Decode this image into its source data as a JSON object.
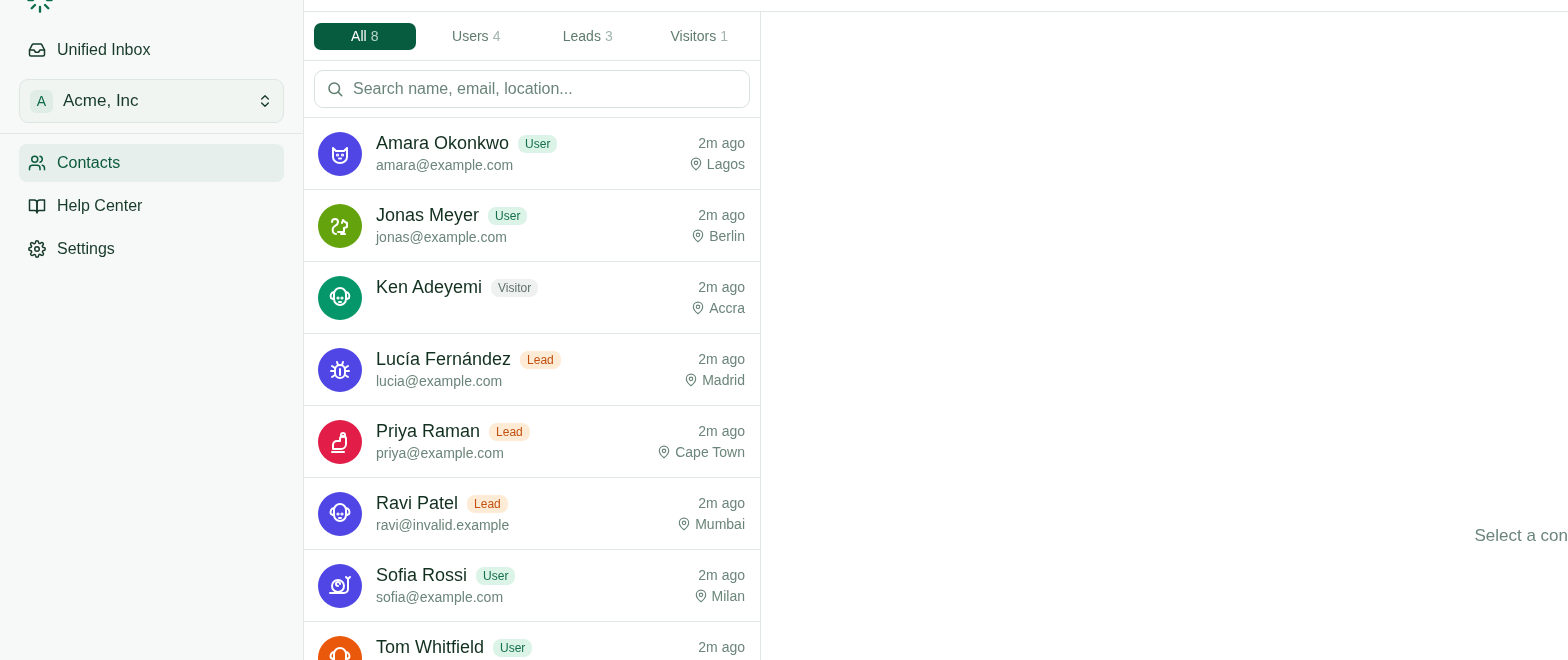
{
  "sidebar": {
    "items": [
      {
        "label": "Unified Inbox",
        "selected": false
      }
    ],
    "workspace": {
      "initial": "A",
      "name": "Acme, Inc"
    },
    "nav": [
      {
        "label": "Contacts",
        "selected": true
      },
      {
        "label": "Help Center",
        "selected": false
      },
      {
        "label": "Settings",
        "selected": false
      }
    ]
  },
  "tabs": [
    {
      "label": "All",
      "count": "8",
      "selected": true
    },
    {
      "label": "Users",
      "count": "4",
      "selected": false
    },
    {
      "label": "Leads",
      "count": "3",
      "selected": false
    },
    {
      "label": "Visitors",
      "count": "1",
      "selected": false
    }
  ],
  "search": {
    "placeholder": "Search name, email, location..."
  },
  "contacts": [
    {
      "name": "Amara Okonkwo",
      "badge": {
        "label": "User",
        "kind": "user"
      },
      "email": "amara@example.com",
      "time": "2m ago",
      "location": "Lagos",
      "color": "#4f46e5"
    },
    {
      "name": "Jonas Meyer",
      "badge": {
        "label": "User",
        "kind": "user"
      },
      "email": "jonas@example.com",
      "time": "2m ago",
      "location": "Berlin",
      "color": "#65a30d"
    },
    {
      "name": "Ken Adeyemi",
      "badge": {
        "label": "Visitor",
        "kind": "visitor"
      },
      "time": "2m ago",
      "location": "Accra",
      "color": "#059669"
    },
    {
      "name": "Lucía Fernández",
      "badge": {
        "label": "Lead",
        "kind": "lead"
      },
      "email": "lucia@example.com",
      "time": "2m ago",
      "location": "Madrid",
      "color": "#4f46e5"
    },
    {
      "name": "Priya Raman",
      "badge": {
        "label": "Lead",
        "kind": "lead"
      },
      "email": "priya@example.com",
      "time": "2m ago",
      "location": "Cape Town",
      "color": "#e11d48"
    },
    {
      "name": "Ravi Patel",
      "badge": {
        "label": "Lead",
        "kind": "lead"
      },
      "email": "ravi@invalid.example",
      "time": "2m ago",
      "location": "Mumbai",
      "color": "#4f46e5"
    },
    {
      "name": "Sofia Rossi",
      "badge": {
        "label": "User",
        "kind": "user"
      },
      "email": "sofia@example.com",
      "time": "2m ago",
      "location": "Milan",
      "color": "#4f46e5"
    },
    {
      "name": "Tom Whitfield",
      "badge": {
        "label": "User",
        "kind": "user"
      },
      "time": "2m ago",
      "color": "#ea580c"
    }
  ],
  "detail": {
    "empty_text": "Select a con"
  }
}
